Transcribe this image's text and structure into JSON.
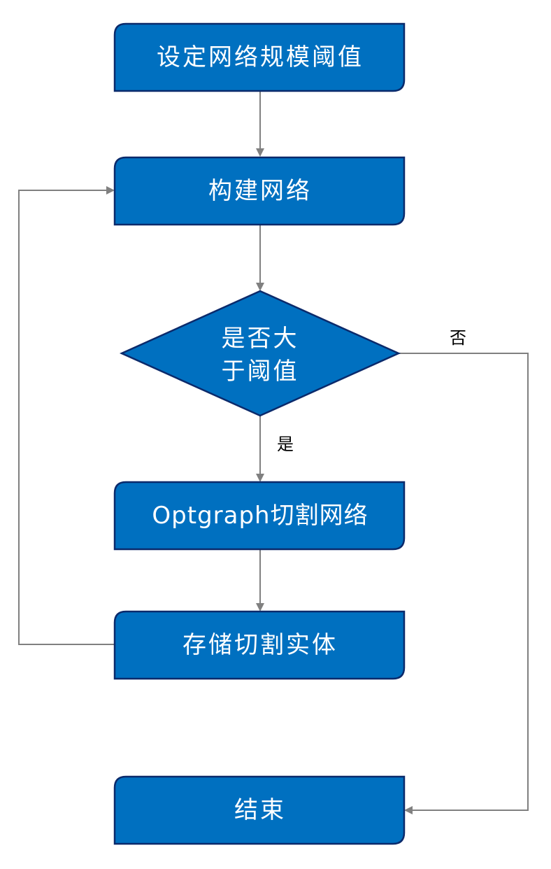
{
  "nodes": {
    "set_threshold": "设定网络规模阈值",
    "build_network": "构建网络",
    "decision_line1": "是否大",
    "decision_line2": "于阈值",
    "cut_network": "Optgraph切割网络",
    "store_entities": "存储切割实体",
    "end": "结束"
  },
  "edge_labels": {
    "yes": "是",
    "no": "否"
  },
  "colors": {
    "node_fill": "#0070C0",
    "node_border": "#0B2A6B",
    "edge": "#808080"
  }
}
